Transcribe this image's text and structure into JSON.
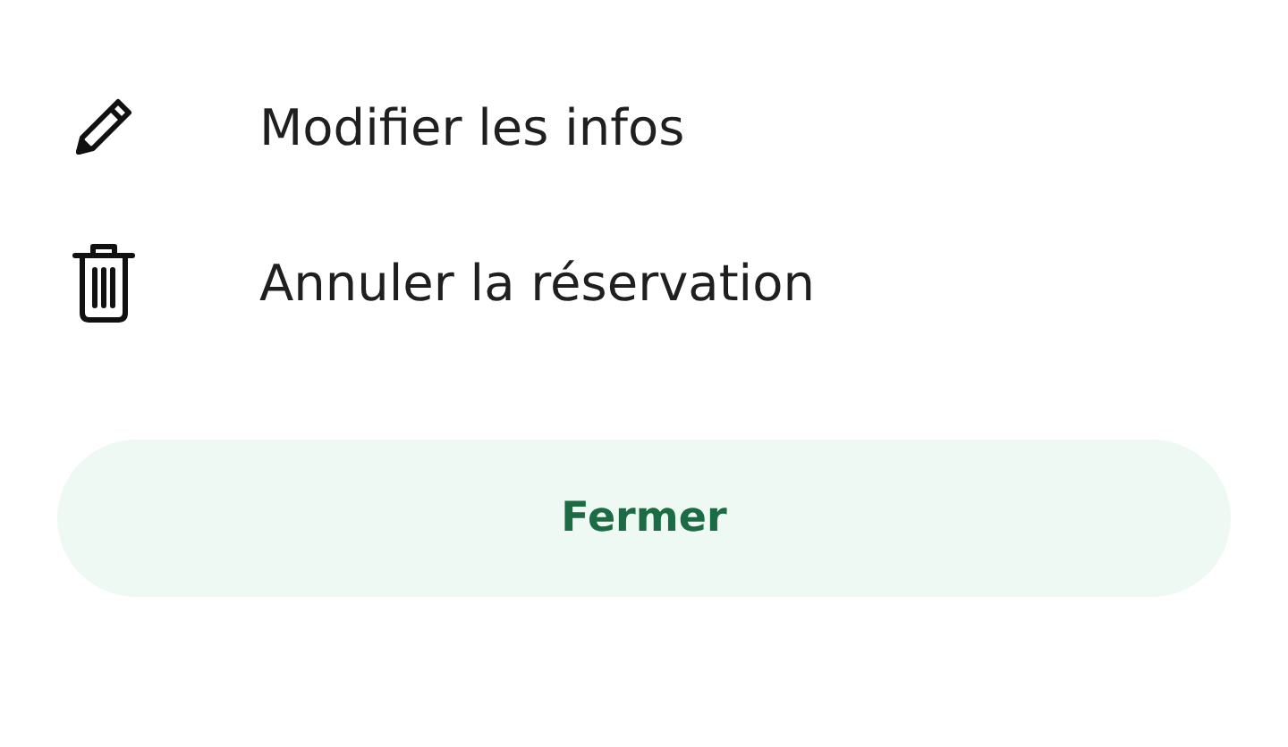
{
  "menu_items": [
    {
      "kind": "edit",
      "label": "Modifier les infos"
    },
    {
      "kind": "delete",
      "label": "Annuler la réservation"
    }
  ],
  "close_button": {
    "label": "Fermer"
  }
}
